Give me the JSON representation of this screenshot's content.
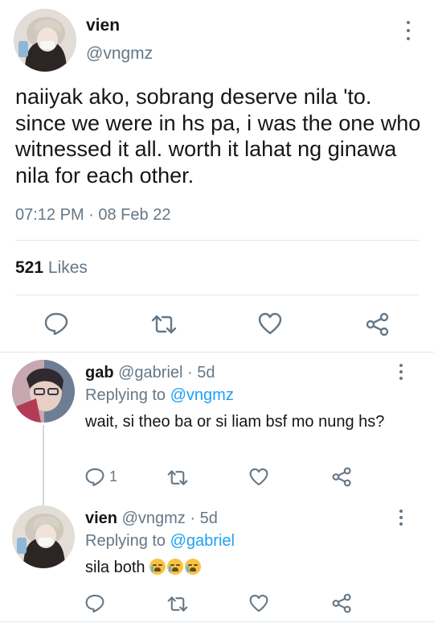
{
  "main_tweet": {
    "name": "vien",
    "handle": "@vngmz",
    "text": "naiiyak ako, sobrang deserve nila 'to. since we were in hs pa, i was the one who witnessed it all. worth it lahat ng ginawa nila for each other.",
    "time": "07:12 PM · 08 Feb 22",
    "likes_count": "521",
    "likes_label": "Likes"
  },
  "replies": [
    {
      "name": "gab",
      "handle": "@gabriel",
      "age": "· 5d",
      "replying_to_label": "Replying to",
      "replying_to": "@vngmz",
      "text": "wait, si theo ba or si liam bsf mo nung hs?",
      "reply_count": "1"
    },
    {
      "name": "vien",
      "handle": "@vngmz",
      "age": "· 5d",
      "replying_to_label": "Replying to",
      "replying_to": "@gabriel",
      "text": "sila both",
      "emoji_count": 3
    }
  ],
  "colors": {
    "text": "#14171a",
    "secondary": "#657786",
    "link": "#1da1f2",
    "divider": "#e1e8ed"
  },
  "icons": [
    "reply-icon",
    "retweet-icon",
    "like-icon",
    "share-icon",
    "more-icon"
  ]
}
